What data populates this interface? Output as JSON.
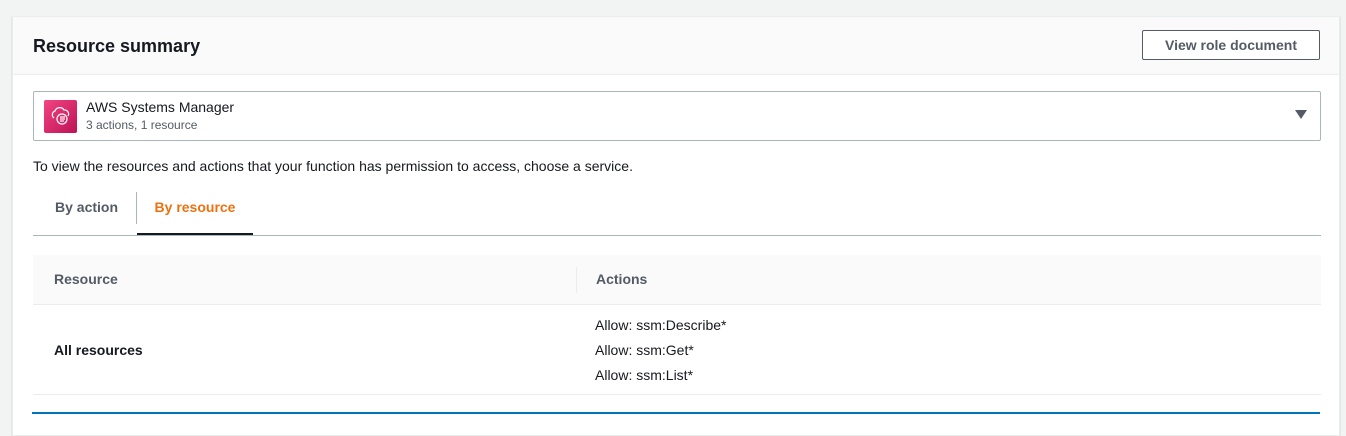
{
  "panel": {
    "title": "Resource summary",
    "view_role_button": "View role document"
  },
  "service": {
    "name": "AWS Systems Manager",
    "summary": "3 actions, 1 resource",
    "icon": "systems-manager-icon"
  },
  "description": "To view the resources and actions that your function has permission to access, choose a service.",
  "tabs": [
    {
      "label": "By action",
      "active": false
    },
    {
      "label": "By resource",
      "active": true
    }
  ],
  "table": {
    "columns": [
      "Resource",
      "Actions"
    ],
    "rows": [
      {
        "resource": "All resources",
        "actions": [
          "Allow: ssm:Describe*",
          "Allow: ssm:Get*",
          "Allow: ssm:List*"
        ]
      }
    ]
  },
  "colors": {
    "accent": "#ec7211",
    "service_icon": "#e7157b",
    "focus": "#0073bb"
  }
}
